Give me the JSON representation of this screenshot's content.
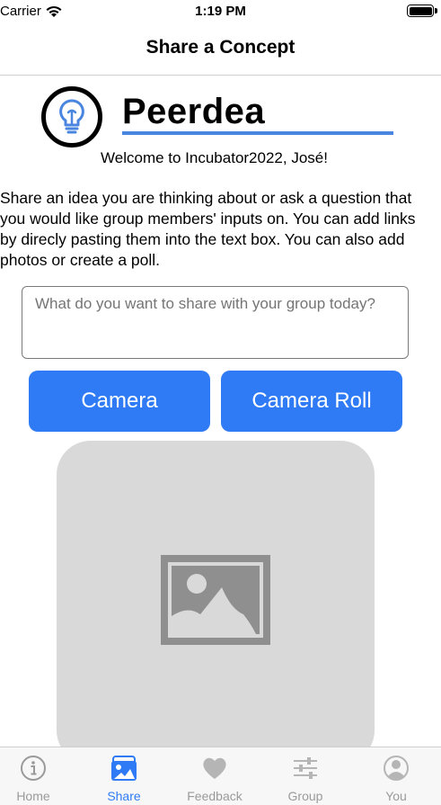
{
  "status_bar": {
    "carrier": "Carrier",
    "time": "1:19 PM",
    "wifi_icon": "wifi-icon",
    "battery_icon": "battery-icon"
  },
  "nav": {
    "title": "Share a Concept"
  },
  "logo": {
    "icon": "lightbulb-icon",
    "brand": "Peerdea",
    "accent_color": "#4a86e0"
  },
  "welcome": "Welcome to Incubator2022, José!",
  "description": "Share an idea you are thinking about or ask a question that you would like group members' inputs on. You can add links by direcly pasting them into the text box. You can also add photos or create a poll.",
  "compose": {
    "placeholder": "What do you want to share with your group today?",
    "value": ""
  },
  "buttons": {
    "camera": "Camera",
    "camera_roll": "Camera Roll",
    "color": "#2f7bf5"
  },
  "photo_placeholder_icon": "image-placeholder-icon",
  "tabs": [
    {
      "label": "Home",
      "icon": "info-icon",
      "active": false
    },
    {
      "label": "Share",
      "icon": "photo-icon",
      "active": true
    },
    {
      "label": "Feedback",
      "icon": "heart-icon",
      "active": false
    },
    {
      "label": "Group",
      "icon": "sliders-icon",
      "active": false
    },
    {
      "label": "You",
      "icon": "person-icon",
      "active": false
    }
  ]
}
